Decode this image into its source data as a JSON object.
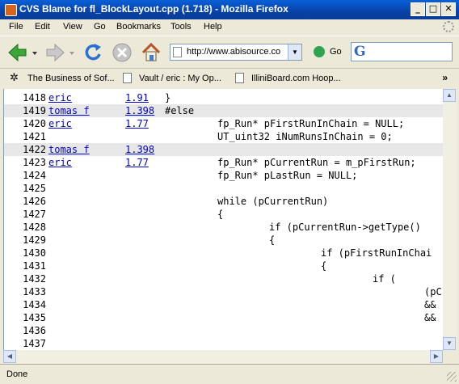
{
  "window": {
    "title": "CVS Blame for fl_BlockLayout.cpp (1.718) - Mozilla Firefox",
    "minimize_glyph": "_",
    "maximize_glyph": "□",
    "close_glyph": "✕"
  },
  "menu": [
    "File",
    "Edit",
    "View",
    "Go",
    "Bookmarks",
    "Tools",
    "Help"
  ],
  "toolbar": {
    "url": "http://www.abisource.co",
    "go_label": "Go",
    "search_engine_glyph": "G"
  },
  "bookmarks": [
    "The Business of Sof...",
    "Vault / eric : My Op...",
    "IlliniBoard.com Hoop..."
  ],
  "bookmarks_more": "»",
  "blame_rows": [
    {
      "line": "1418",
      "author": "eric",
      "rev": "1.91",
      "code": "}",
      "indent": 0,
      "highlight": false
    },
    {
      "line": "1419",
      "author": "tomas f",
      "rev": "1.398",
      "code": "#else",
      "indent": 0,
      "highlight": true
    },
    {
      "line": "1420",
      "author": "eric",
      "rev": "1.77",
      "code": "fp_Run* pFirstRunInChain = NULL;",
      "indent": 1,
      "highlight": false
    },
    {
      "line": "1421",
      "author": "",
      "rev": "",
      "code": "UT_uint32 iNumRunsInChain = 0;",
      "indent": 1,
      "highlight": false
    },
    {
      "line": "1422",
      "author": "tomas f",
      "rev": "1.398",
      "code": "",
      "indent": 0,
      "highlight": true
    },
    {
      "line": "1423",
      "author": "eric",
      "rev": "1.77",
      "code": "fp_Run* pCurrentRun = m_pFirstRun;",
      "indent": 1,
      "highlight": false
    },
    {
      "line": "1424",
      "author": "",
      "rev": "",
      "code": "fp_Run* pLastRun = NULL;",
      "indent": 1,
      "highlight": false
    },
    {
      "line": "1425",
      "author": "",
      "rev": "",
      "code": "",
      "indent": 0,
      "highlight": false
    },
    {
      "line": "1426",
      "author": "",
      "rev": "",
      "code": "while (pCurrentRun)",
      "indent": 1,
      "highlight": false
    },
    {
      "line": "1427",
      "author": "",
      "rev": "",
      "code": "{",
      "indent": 1,
      "highlight": false
    },
    {
      "line": "1428",
      "author": "",
      "rev": "",
      "code": "if (pCurrentRun->getType()",
      "indent": 2,
      "highlight": false
    },
    {
      "line": "1429",
      "author": "",
      "rev": "",
      "code": "{",
      "indent": 2,
      "highlight": false
    },
    {
      "line": "1430",
      "author": "",
      "rev": "",
      "code": "if (pFirstRunInChai",
      "indent": 3,
      "highlight": false
    },
    {
      "line": "1431",
      "author": "",
      "rev": "",
      "code": "{",
      "indent": 3,
      "highlight": false
    },
    {
      "line": "1432",
      "author": "",
      "rev": "",
      "code": "if (",
      "indent": 4,
      "highlight": false
    },
    {
      "line": "1433",
      "author": "",
      "rev": "",
      "code": "(pC",
      "indent": 5,
      "highlight": false
    },
    {
      "line": "1434",
      "author": "",
      "rev": "",
      "code": "&&",
      "indent": 5,
      "highlight": false
    },
    {
      "line": "1435",
      "author": "",
      "rev": "",
      "code": "&&",
      "indent": 5,
      "highlight": false
    },
    {
      "line": "1436",
      "author": "",
      "rev": "",
      "code": "",
      "indent": 0,
      "highlight": false
    },
    {
      "line": "1437",
      "author": "",
      "rev": "",
      "code": "",
      "indent": 0,
      "highlight": false
    }
  ],
  "status": "Done"
}
